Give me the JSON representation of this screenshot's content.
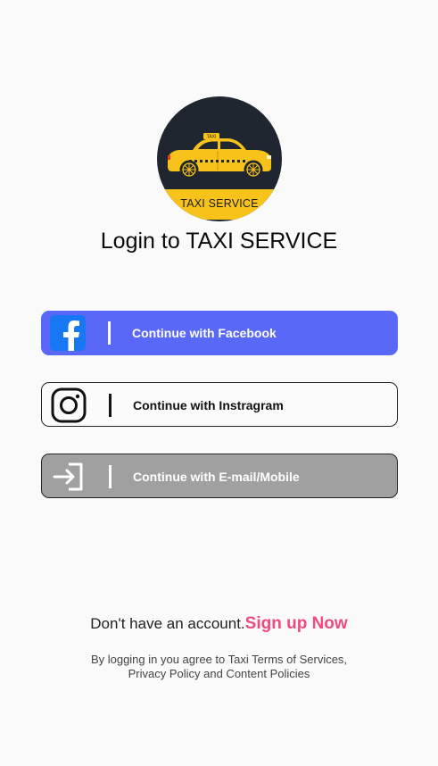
{
  "logo": {
    "band_text": "TAXI SERVICE",
    "roof_sign_text": "TAXI",
    "colors": {
      "circle": "#1f2630",
      "car": "#f7c21a",
      "band": "#f7c21a"
    }
  },
  "title": "Login to TAXI SERVICE",
  "buttons": {
    "facebook": {
      "label": "Continue with Facebook",
      "icon": "facebook-icon",
      "bg": "#5a68f7"
    },
    "instagram": {
      "label": "Continue with Instragram",
      "icon": "instagram-icon",
      "bg": "#fbfbfb"
    },
    "email": {
      "label": "Continue with E-mail/Mobile",
      "icon": "login-arrow-icon",
      "bg": "#a0a0a0"
    }
  },
  "signup": {
    "prompt": "Don't have an account.",
    "link": "Sign up Now",
    "link_color": "#ee4b7f"
  },
  "terms": {
    "line1": "By logging in you agree to Taxi Terms of Services,",
    "line2": "Privacy Policy and Content Policies"
  }
}
